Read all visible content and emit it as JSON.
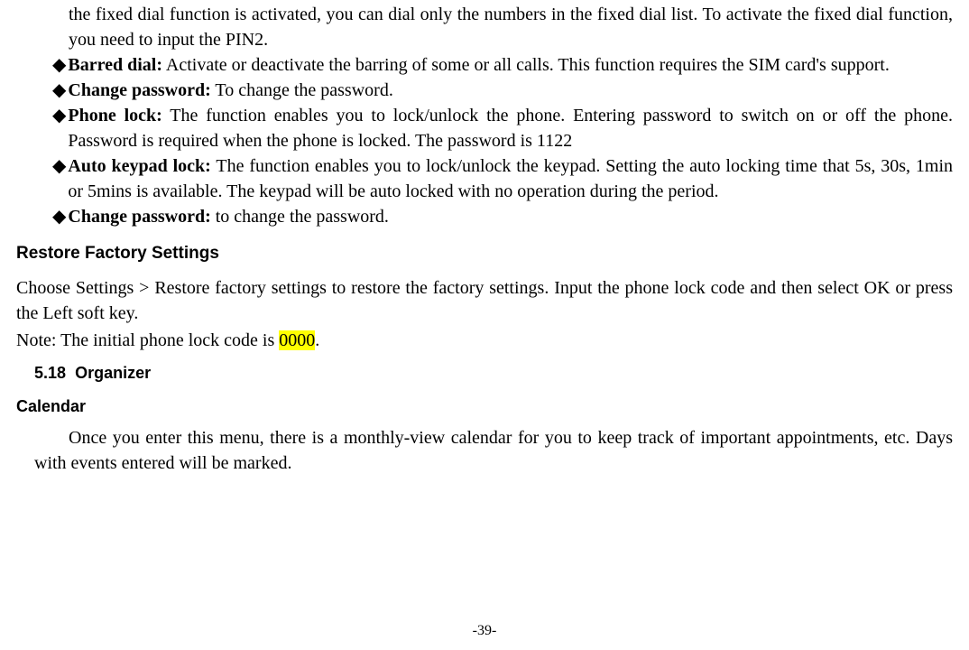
{
  "bullets": {
    "marker": "◆",
    "cont0": "the fixed dial function is activated, you can dial only the numbers in the fixed dial list. To activate the fixed dial function, you need to input the PIN2.",
    "item1_label": "Barred dial:",
    "item1_text": " Activate or deactivate the barring of some or all calls. This function requires the SIM card's support.",
    "item2_label": "Change password:",
    "item2_text": " To change the password.",
    "item3_label": "Phone lock:",
    "item3_text": " The function enables you to lock/unlock the phone. Entering password to switch on or off the phone. Password is required when the phone is locked. The password is 1122",
    "item4_label": "Auto keypad lock:",
    "item4_text": " The function enables you to lock/unlock the keypad. Setting the auto locking time that 5s, 30s, 1min or 5mins is available. The keypad will be auto locked with no operation during the period.",
    "item5_label": "Change password:",
    "item5_text": " to change the password."
  },
  "restore": {
    "heading": "Restore Factory Settings",
    "p1": "Choose Settings > Restore factory settings to restore the factory settings. Input the phone lock code and then select OK or press the Left soft key.",
    "note_prefix": "Note: The initial phone lock code is ",
    "note_code": "0000",
    "note_suffix": "."
  },
  "organizer": {
    "section_num": "5.18",
    "section_title": "Organizer",
    "calendar_heading": "Calendar",
    "calendar_text": "Once you enter this menu, there is a monthly-view calendar for you to keep track of important appointments, etc. Days with events entered will be marked."
  },
  "page_number": "-39-"
}
